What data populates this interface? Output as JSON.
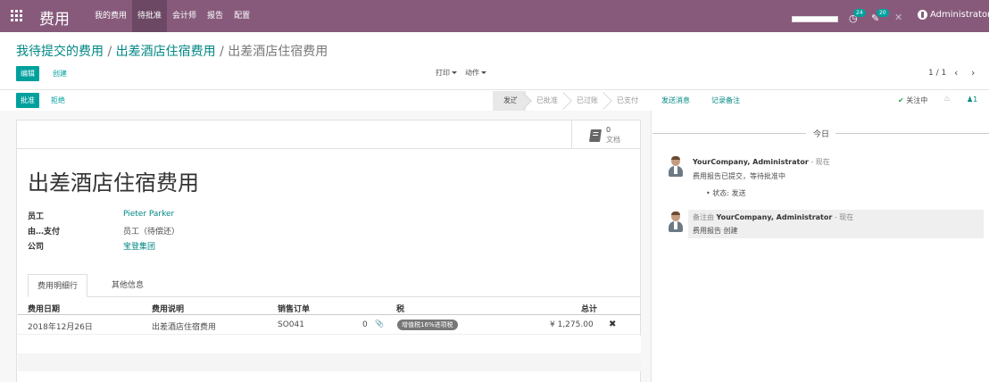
{
  "navbar": {
    "brand": "费用",
    "menu": [
      "我的费用",
      "待批准",
      "会计师",
      "报告",
      "配置"
    ],
    "active_index": 1,
    "badge_activities": "24",
    "badge_messages": "20",
    "user": "Administrator"
  },
  "breadcrumb": {
    "items": [
      "我待提交的费用",
      "出差酒店住宿费用"
    ],
    "current": "出差酒店住宿费用",
    "sep": "/"
  },
  "control": {
    "edit": "编辑",
    "create": "创建",
    "print": "打印",
    "action": "动作",
    "pager": "1 / 1",
    "prev": "‹",
    "next": "›"
  },
  "statusbar": {
    "approve": "批准",
    "refuse": "拒绝",
    "stages": [
      "发送",
      "已批准",
      "已过账",
      "已支付"
    ],
    "current_stage": "发送"
  },
  "form": {
    "docs_count": "0",
    "docs_label": "文档",
    "title": "出差酒店住宿费用",
    "fields": [
      {
        "label": "员工",
        "value": "Pieter Parker",
        "link": true
      },
      {
        "label": "由…支付",
        "value": "员工（待偿还）",
        "link": false
      },
      {
        "label": "公司",
        "value": "宝登集团",
        "link": true
      }
    ],
    "tabs": [
      "费用明细行",
      "其他信息"
    ],
    "columns": [
      "费用日期",
      "费用说明",
      "销售订单",
      "税",
      "总计"
    ],
    "rows": [
      {
        "date": "2018年12月26日",
        "desc": "出差酒店住宿费用",
        "order": "SO041",
        "qty": "0",
        "tax": "增值税16%进项税",
        "total": "¥ 1,275.00"
      }
    ]
  },
  "chatter": {
    "send": "发送消息",
    "note": "记录备注",
    "follow": "关注中",
    "followers": "1",
    "date": "今日",
    "messages": [
      {
        "prefix": "",
        "author": "YourCompany, Administrator",
        "when": "现在",
        "body": "费用报告已提交，等待批准中",
        "tracking": "状态: 发送"
      },
      {
        "prefix": "备注由 ",
        "author": "YourCompany, Administrator",
        "when": "现在",
        "body": "费用报告 创建",
        "tracking": ""
      }
    ]
  },
  "colors": {
    "navbar": "#875a7b",
    "primary": "#00a09d",
    "link": "#008784"
  }
}
